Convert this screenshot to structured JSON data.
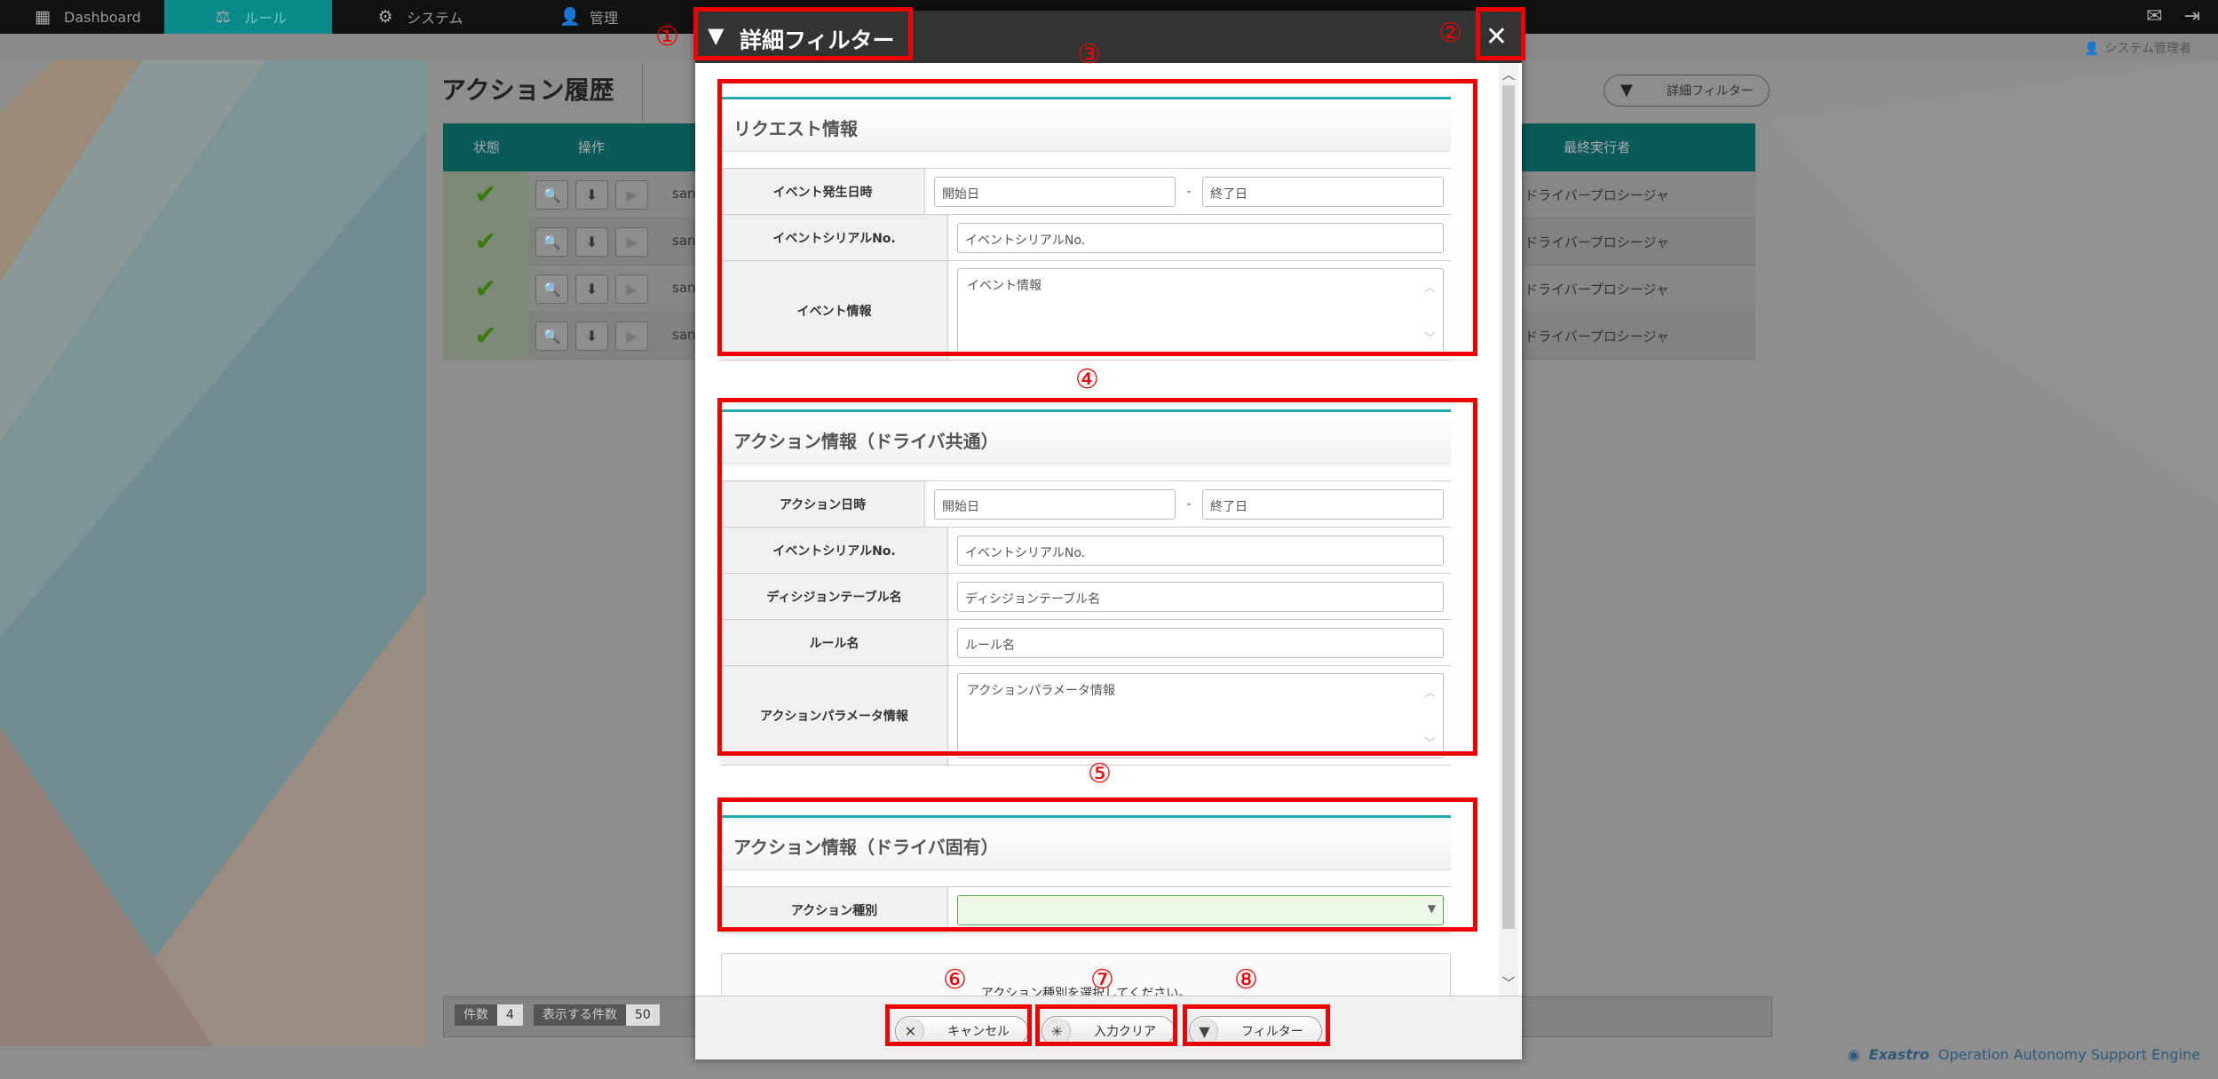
{
  "nav": {
    "items": [
      {
        "label": "Dashboard",
        "icon": "dashboard-icon",
        "glyph": "▦"
      },
      {
        "label": "ルール",
        "icon": "scale-icon",
        "glyph": "⚖"
      },
      {
        "label": "システム",
        "icon": "system-icon",
        "glyph": "⚙"
      },
      {
        "label": "管理",
        "icon": "admin-icon",
        "glyph": "👤"
      }
    ],
    "user_label": "システム管理者"
  },
  "page": {
    "title": "アクション履歴",
    "filter_button_label": "詳細フィルター",
    "table": {
      "headers": {
        "status": "状態",
        "operation": "操作",
        "last_executor": "最終実行者"
      },
      "rows": [
        {
          "name": "san",
          "executor": "ドライバープロシージャ"
        },
        {
          "name": "san",
          "executor": "ドライバープロシージャ"
        },
        {
          "name": "san",
          "executor": "ドライバープロシージャ"
        },
        {
          "name": "san",
          "executor": "ドライバープロシージャ"
        }
      ]
    },
    "footer": {
      "count_label": "件数",
      "count_value": "4",
      "per_page_label": "表示する件数",
      "per_page_value": "50"
    },
    "brand": {
      "bold": "Exastro",
      "rest": "Operation Autonomy Support Engine"
    }
  },
  "modal": {
    "title": "詳細フィルター",
    "close_glyph": "✕",
    "sections": {
      "request": {
        "title": "リクエスト情報",
        "fields": {
          "event_datetime": {
            "label": "イベント発生日時",
            "start_placeholder": "開始日",
            "end_placeholder": "終了日",
            "separator": "-"
          },
          "event_serial": {
            "label": "イベントシリアルNo.",
            "placeholder": "イベントシリアルNo."
          },
          "event_info": {
            "label": "イベント情報",
            "placeholder": "イベント情報"
          }
        }
      },
      "action_common": {
        "title": "アクション情報（ドライバ共通）",
        "fields": {
          "action_datetime": {
            "label": "アクション日時",
            "start_placeholder": "開始日",
            "end_placeholder": "終了日",
            "separator": "-"
          },
          "event_serial": {
            "label": "イベントシリアルNo.",
            "placeholder": "イベントシリアルNo."
          },
          "decision_table": {
            "label": "ディシジョンテーブル名",
            "placeholder": "ディシジョンテーブル名"
          },
          "rule_name": {
            "label": "ルール名",
            "placeholder": "ルール名"
          },
          "action_params": {
            "label": "アクションパラメータ情報",
            "placeholder": "アクションパラメータ情報"
          }
        }
      },
      "action_specific": {
        "title": "アクション情報（ドライバ固有）",
        "fields": {
          "action_type": {
            "label": "アクション種別",
            "value": ""
          }
        }
      }
    },
    "notice": "アクション種別を選択してください。",
    "buttons": {
      "cancel": "キャンセル",
      "clear": "入力クリア",
      "filter": "フィルター"
    }
  },
  "annotations": [
    "①",
    "②",
    "③",
    "④",
    "⑤",
    "⑥",
    "⑦",
    "⑧"
  ],
  "colors": {
    "accent": "#0a8a8a",
    "annotation": "#e00000",
    "header_dark": "#333333"
  }
}
